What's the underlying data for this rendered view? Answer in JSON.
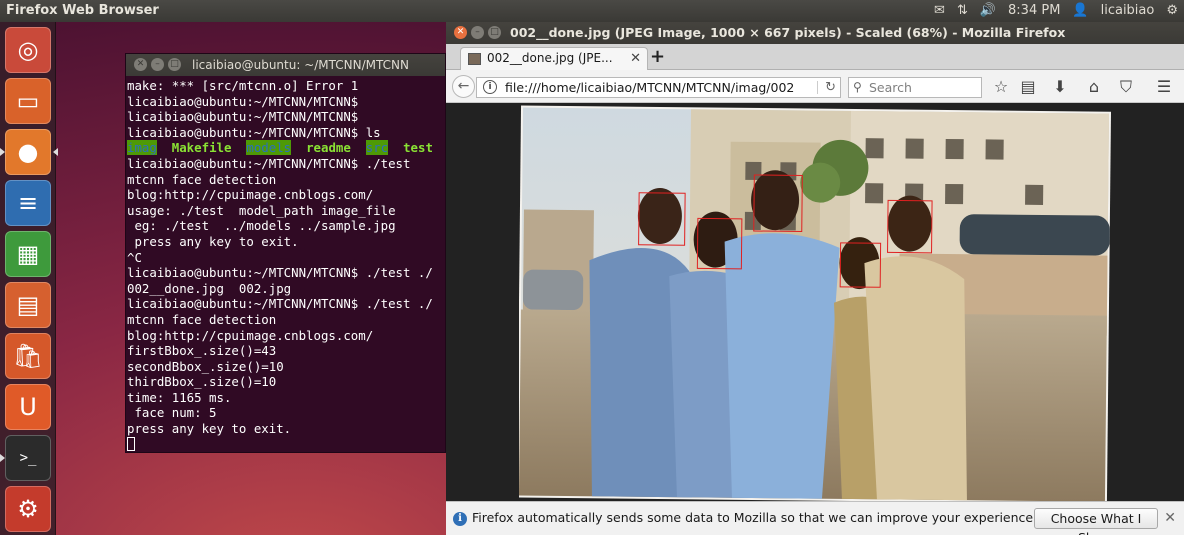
{
  "top_panel": {
    "app_title": "Firefox Web Browser",
    "time": "8:34 PM",
    "user": "licaibiao",
    "icons": [
      "mail-icon",
      "network-arrows-icon",
      "volume-icon",
      "gear-icon"
    ]
  },
  "launcher": {
    "items": [
      {
        "name": "ubuntu-dash",
        "glyph": "◎",
        "color": "#c94a3a"
      },
      {
        "name": "files",
        "glyph": "▭",
        "color": "#d9622a"
      },
      {
        "name": "firefox",
        "glyph": "●",
        "color": "#e2782b"
      },
      {
        "name": "libreoffice-writer",
        "glyph": "≡",
        "color": "#2f6db0"
      },
      {
        "name": "libreoffice-calc",
        "glyph": "▦",
        "color": "#3e9a3c"
      },
      {
        "name": "libreoffice-impress",
        "glyph": "▤",
        "color": "#d6602f"
      },
      {
        "name": "software-center",
        "glyph": "🛍",
        "color": "#d5582a"
      },
      {
        "name": "ubuntu-one",
        "glyph": "U",
        "color": "#e05a28"
      },
      {
        "name": "terminal",
        "glyph": ">_",
        "color": "#2b2b2b"
      },
      {
        "name": "workspace-switcher",
        "glyph": "⚙",
        "color": "#c43b2c"
      }
    ]
  },
  "terminal": {
    "title": "licaibiao@ubuntu: ~/MTCNN/MTCNN",
    "lines": [
      "make: *** [src/mtcnn.o] Error 1",
      "licaibiao@ubuntu:~/MTCNN/MTCNN$",
      "licaibiao@ubuntu:~/MTCNN/MTCNN$",
      "licaibiao@ubuntu:~/MTCNN/MTCNN$ ls",
      "@@LS@@",
      "licaibiao@ubuntu:~/MTCNN/MTCNN$ ./test",
      "mtcnn face detection",
      "blog:http://cpuimage.cnblogs.com/",
      "usage: ./test  model_path image_file",
      " eg: ./test  ../models ../sample.jpg",
      " press any key to exit.",
      "^C",
      "licaibiao@ubuntu:~/MTCNN/MTCNN$ ./test ./",
      "002__done.jpg  002.jpg",
      "licaibiao@ubuntu:~/MTCNN/MTCNN$ ./test ./",
      "mtcnn face detection",
      "blog:http://cpuimage.cnblogs.com/",
      "firstBbox_.size()=43",
      "secondBbox_.size()=10",
      "thirdBbox_.size()=10",
      "time: 1165 ms.",
      " face num: 5",
      "press any key to exit."
    ],
    "ls_output": [
      {
        "text": "imag",
        "kind": "dir"
      },
      {
        "text": "Makefile",
        "kind": "exe"
      },
      {
        "text": "models",
        "kind": "dir"
      },
      {
        "text": "readme",
        "kind": "exe"
      },
      {
        "text": "src",
        "kind": "dir"
      },
      {
        "text": "test",
        "kind": "exe"
      }
    ]
  },
  "firefox": {
    "window_title": "002__done.jpg (JPEG Image, 1000 × 667 pixels) - Scaled (68%) - Mozilla Firefox",
    "tab_title": "002__done.jpg (JPE...",
    "url": "file:///home/licaibiao/MTCNN/MTCNN/imag/002",
    "search_placeholder": "Search",
    "notification": "Firefox automatically sends some data to Mozilla so that we can improve your experience.",
    "notification_button": "Choose What I Share",
    "face_count": 5
  }
}
